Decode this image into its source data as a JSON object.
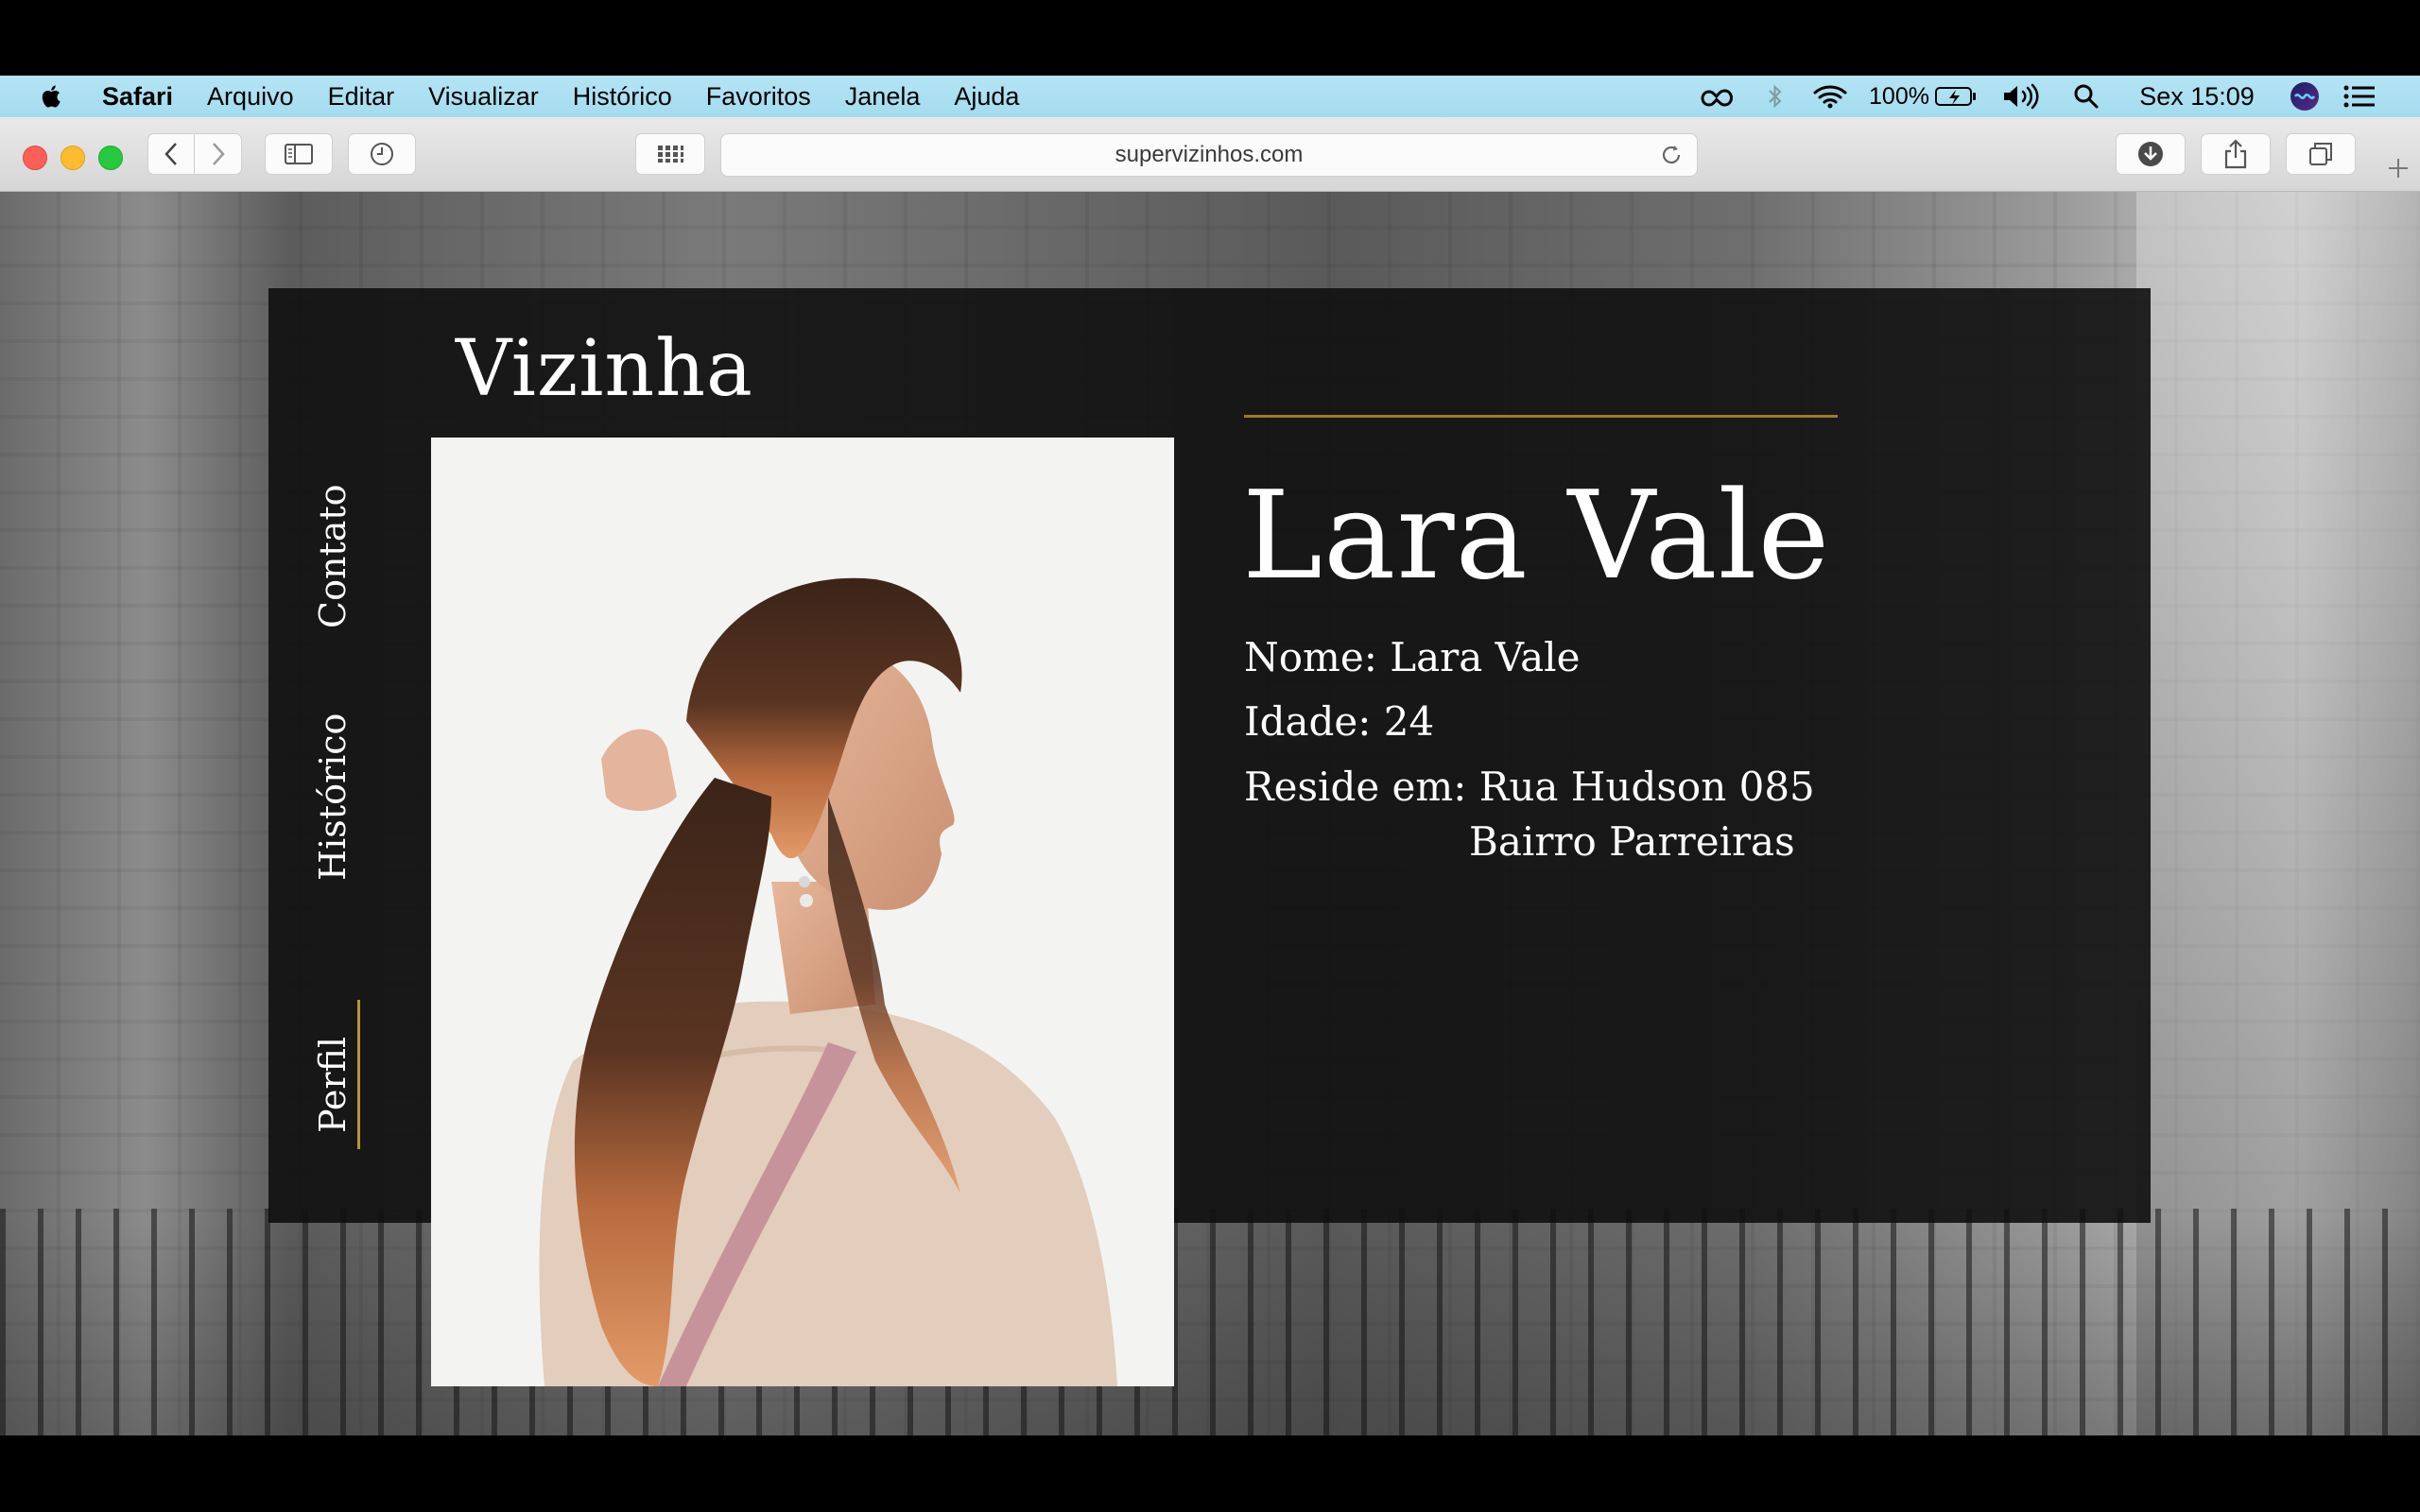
{
  "menubar": {
    "app_name": "Safari",
    "items": [
      "Arquivo",
      "Editar",
      "Visualizar",
      "Histórico",
      "Favoritos",
      "Janela",
      "Ajuda"
    ],
    "battery_percent": "100%",
    "clock": "Sex 15:09",
    "icons": [
      "creative-cloud-icon",
      "bluetooth-icon",
      "wifi-icon",
      "battery-icon",
      "volume-icon",
      "spotlight-search-icon",
      "siri-icon",
      "control-center-list-icon"
    ]
  },
  "toolbar": {
    "url": "supervizinhos.com",
    "icons": [
      "back-icon",
      "forward-icon",
      "sidebar-icon",
      "history-clock-icon",
      "grid-icon",
      "reload-icon",
      "download-icon",
      "share-icon",
      "tabs-icon",
      "new-tab-plus-icon"
    ]
  },
  "page": {
    "brand": "Vizinha",
    "nav": [
      "Contato",
      "Histórico",
      "Perfil"
    ],
    "active_nav": "Perfil",
    "name_title": "Lara Vale",
    "name_line": "Nome: Lara Vale",
    "age_line": "Idade: 24",
    "address_line1": "Reside em: Rua Hudson 085",
    "address_line2": "Bairro Parreiras",
    "accent_color": "#b8972f"
  }
}
